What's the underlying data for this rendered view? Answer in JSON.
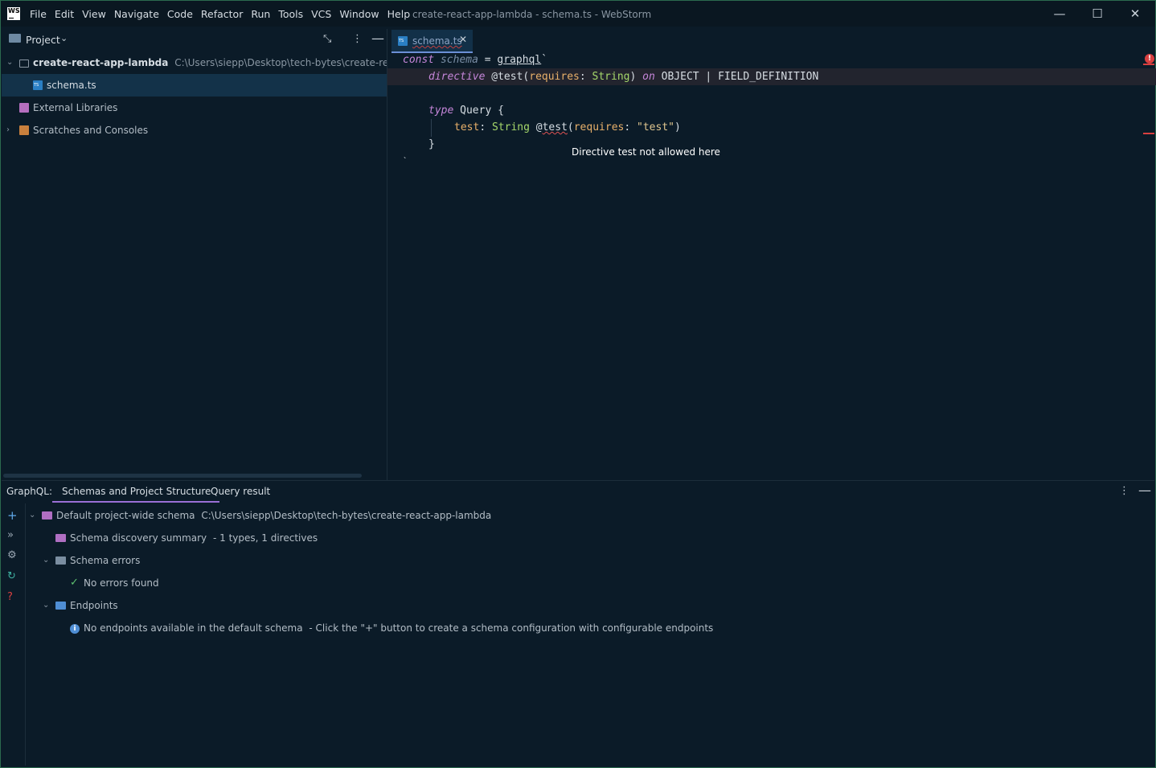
{
  "app": {
    "logo_text": "WS",
    "menu": [
      "File",
      "Edit",
      "View",
      "Navigate",
      "Code",
      "Refactor",
      "Run",
      "Tools",
      "VCS",
      "Window",
      "Help"
    ],
    "window_title": "create-react-app-lambda - schema.ts - WebStorm",
    "controls": {
      "minimize": "—",
      "maximize": "☐",
      "close": "✕"
    }
  },
  "project": {
    "title": "Project",
    "root_name": "create-react-app-lambda",
    "root_path": "C:\\Users\\siepp\\Desktop\\tech-bytes\\create-react-app-lambda",
    "file": "schema.ts",
    "external": "External Libraries",
    "scratches": "Scratches and Consoles"
  },
  "editor": {
    "tab_label": "schema.ts",
    "tooltip": "Directive test not allowed here",
    "code": {
      "l1_const": "const",
      "l1_var": "schema",
      "l1_eq": "=",
      "l1_fn": "graphql",
      "l1_tick": "`",
      "l2_kw": "directive",
      "l2_name": "@test(",
      "l2_arg": "requires",
      "l2_colon": ": ",
      "l2_type": "String",
      "l2_close": ")",
      "l2_on": "on",
      "l2_locs": "OBJECT | FIELD_DEFINITION",
      "l4_kw": "type",
      "l4_name": "Query {",
      "l5_field": "test",
      "l5_colon": ": ",
      "l5_type": "String",
      "l5_at": "@",
      "l5_dir": "test",
      "l5_paren": "(",
      "l5_arg": "requires",
      "l5_colon2": ": ",
      "l5_str": "\"test\"",
      "l5_close": ")",
      "l6": "}",
      "l7": "`"
    }
  },
  "graphql": {
    "label": "GraphQL:",
    "tabs": [
      "Schemas and Project Structure",
      "Query result"
    ],
    "schema_name": "Default project-wide schema",
    "schema_path": "C:\\Users\\siepp\\Desktop\\tech-bytes\\create-react-app-lambda",
    "discovery": "Schema discovery summary",
    "discovery_detail": "- 1 types, 1 directives",
    "errors": "Schema errors",
    "no_errors": "No errors found",
    "endpoints": "Endpoints",
    "no_endpoints": "No endpoints available in the default schema",
    "no_endpoints_hint": "- Click the \"+\" button to create a schema configuration with configurable endpoints"
  }
}
